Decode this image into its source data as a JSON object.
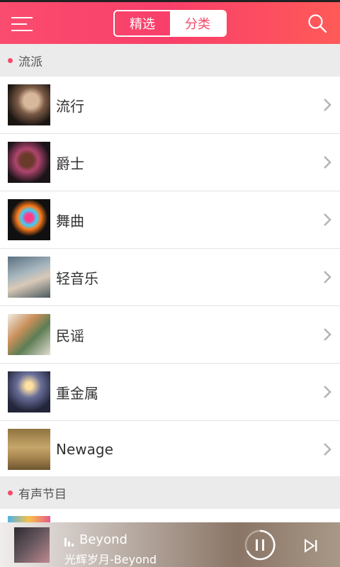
{
  "header": {
    "tabs": [
      {
        "label": "精选",
        "active": false
      },
      {
        "label": "分类",
        "active": true
      }
    ],
    "accent": "#f54a68"
  },
  "sections": {
    "genres": "流派",
    "audio_programs": "有声节目"
  },
  "genres": [
    {
      "label": "流行",
      "thumb": "portrait-photo"
    },
    {
      "label": "爵士",
      "thumb": "singer-microphone-photo"
    },
    {
      "label": "舞曲",
      "thumb": "colorful-paint-splash"
    },
    {
      "label": "轻音乐",
      "thumb": "relaxing-person-photo"
    },
    {
      "label": "民谣",
      "thumb": "guitar-player-photo"
    },
    {
      "label": "重金属",
      "thumb": "rock-guitarist-photo"
    },
    {
      "label": "Newage",
      "thumb": "desert-figure-photo"
    }
  ],
  "player": {
    "title": "Beyond",
    "subtitle": "光辉岁月-Beyond"
  }
}
